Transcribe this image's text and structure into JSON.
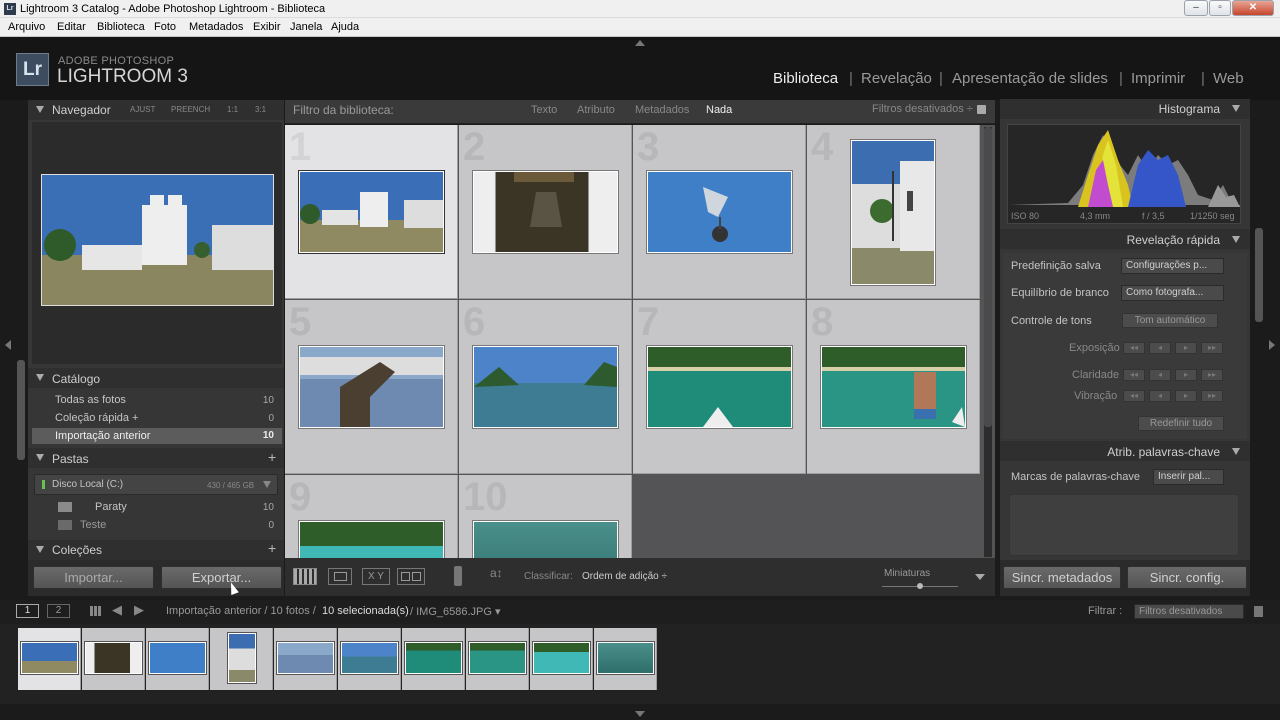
{
  "window": {
    "title": "Lightroom 3 Catalog - Adobe Photoshop Lightroom - Biblioteca",
    "icon": "Lr"
  },
  "menu": [
    "Arquivo",
    "Editar",
    "Biblioteca",
    "Foto",
    "Metadados",
    "Exibir",
    "Janela",
    "Ajuda"
  ],
  "brand": {
    "line1": "ADOBE PHOTOSHOP",
    "line2": "LIGHTROOM 3",
    "logo": "Lr"
  },
  "modules": [
    "Biblioteca",
    "Revelação",
    "Apresentação de slides",
    "Imprimir",
    "Web"
  ],
  "active_module": "Biblioteca",
  "left": {
    "navigator": {
      "title": "Navegador",
      "opts": [
        "AJUST",
        "PREENCH",
        "1:1",
        "3:1"
      ]
    },
    "catalog": {
      "title": "Catálogo",
      "items": [
        {
          "label": "Todas as fotos",
          "count": "10"
        },
        {
          "label": "Coleção rápida +",
          "count": "0"
        },
        {
          "label": "Importação anterior",
          "count": "10"
        }
      ]
    },
    "folders": {
      "title": "Pastas",
      "disk": "Disco Local (C:)",
      "disk_size": "430 / 465 GB",
      "items": [
        {
          "label": "Paraty",
          "count": "10"
        },
        {
          "label": "Teste",
          "count": "0"
        }
      ]
    },
    "collections": {
      "title": "Coleções"
    },
    "import_label": "Importar...",
    "export_label": "Exportar..."
  },
  "filterbar": {
    "title": "Filtro da biblioteca:",
    "tabs": [
      "Texto",
      "Atributo",
      "Metadados",
      "Nada"
    ],
    "active": "Nada",
    "status": "Filtros desativados ÷"
  },
  "grid": {
    "numbers": [
      "1",
      "2",
      "3",
      "4",
      "5",
      "6",
      "7",
      "8",
      "9",
      "10"
    ],
    "selected": "1"
  },
  "toolbar": {
    "sort_label": "Classificar:",
    "sort_value": "Ordem de adição ÷",
    "thumb_label": "Miniaturas",
    "thumb_size": 0.5
  },
  "right": {
    "histogram": {
      "title": "Histograma",
      "iso": "ISO 80",
      "focal": "4,3 mm",
      "fstop": "f / 3,5",
      "shutter": "1/1250 seg"
    },
    "quick": {
      "title": "Revelação rápida",
      "preset_label": "Predefinição salva",
      "preset_value": "Configurações p...",
      "wb_label": "Equilíbrio de branco",
      "wb_value": "Como fotografa...",
      "tone_label": "Controle de tons",
      "tone_btn": "Tom automático",
      "exposure": "Exposição",
      "clarity": "Claridade",
      "vibrance": "Vibração",
      "reset": "Redefinir tudo"
    },
    "keywords": {
      "title": "Atrib. palavras-chave",
      "tags_label": "Marcas de palavras-chave",
      "tags_value": "Inserir pal..."
    },
    "sync_meta": "Sincr. metadados",
    "sync_settings": "Sincr. config."
  },
  "filmstrip": {
    "pages": [
      "1",
      "2"
    ],
    "source": "Importação anterior / 10 fotos /",
    "selected_text": "10 selecionada(s)",
    "file": "/ IMG_6586.JPG ▾",
    "filter_label": "Filtrar :",
    "filter_value": "Filtros desativados"
  }
}
